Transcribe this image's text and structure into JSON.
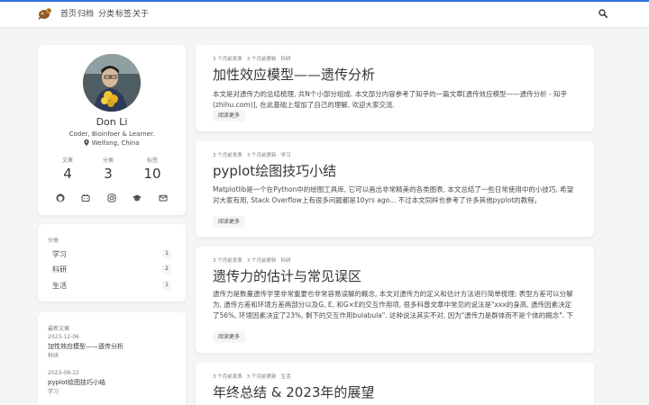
{
  "nav": {
    "items": [
      {
        "label": "首页",
        "active": true
      },
      {
        "label": "归档",
        "active": false
      },
      {
        "label": "分类",
        "active": false
      },
      {
        "label": "标签",
        "active": false
      },
      {
        "label": "关于",
        "active": false
      }
    ],
    "accent_color": "#3273dc"
  },
  "profile": {
    "name": "Don Li",
    "description": "Coder, Bioinfoer & Learner.",
    "location": "Weifang, China",
    "stats": [
      {
        "label": "文章",
        "value": "4"
      },
      {
        "label": "分类",
        "value": "3"
      },
      {
        "label": "标签",
        "value": "10"
      }
    ],
    "social_icons": [
      "github-icon",
      "bilibili-icon",
      "instagram-icon",
      "scholar-icon",
      "email-icon"
    ]
  },
  "categories": {
    "title": "分类",
    "items": [
      {
        "name": "学习",
        "count": "1"
      },
      {
        "name": "科研",
        "count": "2"
      },
      {
        "name": "生活",
        "count": "1"
      }
    ]
  },
  "recent": {
    "title": "最新文章",
    "items": [
      {
        "date": "2023-12-06",
        "title": "加性效应模型——遗传分析",
        "category": "科研"
      },
      {
        "date": "2023-08-22",
        "title": "pyplot绘图技巧小结",
        "category": "学习"
      }
    ]
  },
  "posts": [
    {
      "meta": [
        "3 个月前发表",
        "3 个月前更新",
        "科研"
      ],
      "title": "加性效应模型——遗传分析",
      "excerpt": "本文是对遗传力的总结梳理, 共N个小部分组成. 本文部分内容参考了知乎的一篇文章[遗传效应模型——遗传分析 - 知乎 (zhihu.com)], 在此基础上增加了自己的理解, 欢迎大家交流.",
      "read_more": "阅读更多"
    },
    {
      "meta": [
        "3 个月前发表",
        "3 个月前更新",
        "学习"
      ],
      "title": "pyplot绘图技巧小结",
      "excerpt": "Matplotlib是一个在Python中的绘图工具库, 它可以画出非常精美的各类图表, 本文总结了一些日常使用中的小技巧, 希望对大家有用, Stack Overflow上有很多问题都是10yrs ago... 不过本文同样也参考了许多其他pyplot的教程。",
      "read_more": "阅读更多"
    },
    {
      "meta": [
        "3 个月前发表",
        "3 个月前更新",
        "科研"
      ],
      "title": "遗传力的估计与常见误区",
      "excerpt": "遗传力是数量遗传学里非常重要也非常容易误解的概念, 本文对遗传力的定义和估计方法进行简单梳理; 表型方差可以分解为, 遗传方差和环境方差两部分以及G, E, 和G×E的交互作用项, 很多科普文章中常见的说法是\"xxx的身高, 遗传因素决定了56%, 环境因素决定了23%, 剩下的交互作用bulabula\". 这种说法其实不对, 因为\"遗传力是群体而不是个体的概念\". 下面, 我们详细讨论遗传力的几个问题.",
      "read_more": "阅读更多"
    },
    {
      "meta": [
        "3 个月前发表",
        "3 个月前更新",
        "生活"
      ],
      "title": "年终总结 & 2023年的展望",
      "excerpt": "",
      "read_more": ""
    }
  ]
}
